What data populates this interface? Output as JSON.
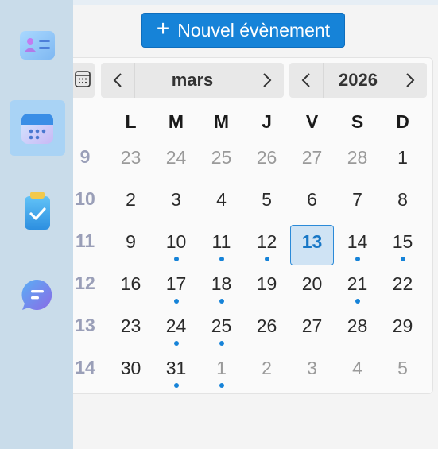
{
  "rail": {
    "items": [
      {
        "name": "contacts",
        "icon": "contact-card-icon",
        "active": false
      },
      {
        "name": "calendar",
        "icon": "calendar-icon",
        "active": true
      },
      {
        "name": "tasks",
        "icon": "clipboard-check-icon",
        "active": false
      },
      {
        "name": "chat",
        "icon": "chat-bubble-icon",
        "active": false
      }
    ]
  },
  "toolbar": {
    "new_event_label": "Nouvel évènement",
    "new_event_icon": "plus-icon"
  },
  "calendar": {
    "month_label": "mars",
    "year_label": "2026",
    "weekday_headers": [
      "L",
      "M",
      "M",
      "J",
      "V",
      "S",
      "D"
    ],
    "weeks": [
      {
        "week": "9",
        "days": [
          [
            "23",
            true,
            false
          ],
          [
            "24",
            true,
            false
          ],
          [
            "25",
            true,
            false
          ],
          [
            "26",
            true,
            false
          ],
          [
            "27",
            true,
            false
          ],
          [
            "28",
            true,
            false
          ],
          [
            "1",
            false,
            false
          ]
        ]
      },
      {
        "week": "10",
        "days": [
          [
            "2",
            false,
            false
          ],
          [
            "3",
            false,
            false
          ],
          [
            "4",
            false,
            false
          ],
          [
            "5",
            false,
            false
          ],
          [
            "6",
            false,
            false
          ],
          [
            "7",
            false,
            false
          ],
          [
            "8",
            false,
            false
          ]
        ]
      },
      {
        "week": "11",
        "days": [
          [
            "9",
            false,
            false
          ],
          [
            "10",
            false,
            true
          ],
          [
            "11",
            false,
            true
          ],
          [
            "12",
            false,
            true
          ],
          [
            "13",
            false,
            false
          ],
          [
            "14",
            false,
            true
          ],
          [
            "15",
            false,
            true
          ]
        ]
      },
      {
        "week": "12",
        "days": [
          [
            "16",
            false,
            false
          ],
          [
            "17",
            false,
            true
          ],
          [
            "18",
            false,
            true
          ],
          [
            "19",
            false,
            false
          ],
          [
            "20",
            false,
            false
          ],
          [
            "21",
            false,
            true
          ],
          [
            "22",
            false,
            false
          ]
        ]
      },
      {
        "week": "13",
        "days": [
          [
            "23",
            false,
            false
          ],
          [
            "24",
            false,
            true
          ],
          [
            "25",
            false,
            true
          ],
          [
            "26",
            false,
            false
          ],
          [
            "27",
            false,
            false
          ],
          [
            "28",
            false,
            false
          ],
          [
            "29",
            false,
            false
          ]
        ]
      },
      {
        "week": "14",
        "days": [
          [
            "30",
            false,
            false
          ],
          [
            "31",
            false,
            true
          ],
          [
            "1",
            true,
            true
          ],
          [
            "2",
            true,
            false
          ],
          [
            "3",
            true,
            false
          ],
          [
            "4",
            true,
            false
          ],
          [
            "5",
            true,
            false
          ]
        ]
      }
    ],
    "today": "13",
    "event_dot_color": "#1683d8"
  },
  "colors": {
    "accent": "#1683d8",
    "rail_bg": "#c9dcea",
    "rail_active": "#a9d3f5",
    "today_bg": "#cfe3f4"
  }
}
